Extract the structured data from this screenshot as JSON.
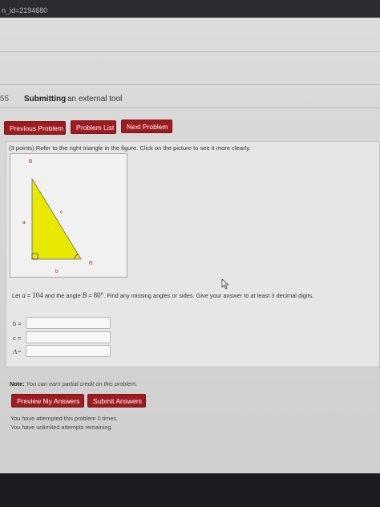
{
  "browser": {
    "url_fragment": "n_id=2194680"
  },
  "breadcrumb": {
    "number": "55",
    "title": "Submitting",
    "subtitle": "an external tool"
  },
  "nav": {
    "previous": "Previous Problem",
    "list": "Problem List",
    "next": "Next Problem"
  },
  "problem": {
    "intro": "(3 points) Refer to the right triangle in the figure. Click on the picture to see it more clearly.",
    "figure": {
      "B": "B",
      "c": "c",
      "a": "a",
      "R": "R",
      "b": "b",
      "fill_color": "#e8e800"
    },
    "prompt_pre": "Let ",
    "var_a": "a",
    "eq1": " = ",
    "val_a": "104",
    "prompt_mid": " and the angle ",
    "var_B": "B",
    "eq2": " = ",
    "val_B": "80°",
    "prompt_post": ". Find any missing angles or sides. Give your answer to at least 3 decimal digits.",
    "fields": [
      {
        "label": "b =",
        "value": ""
      },
      {
        "label": "c =",
        "value": ""
      },
      {
        "label": "A=",
        "value": ""
      }
    ]
  },
  "note": {
    "label": "Note:",
    "text": " You can earn partial credit on this problem."
  },
  "actions": {
    "preview": "Preview My Answers",
    "submit": "Submit Answers"
  },
  "status": {
    "attempted": "You have attempted this problem 0 times.",
    "remaining": "You have unlimited attempts remaining."
  }
}
